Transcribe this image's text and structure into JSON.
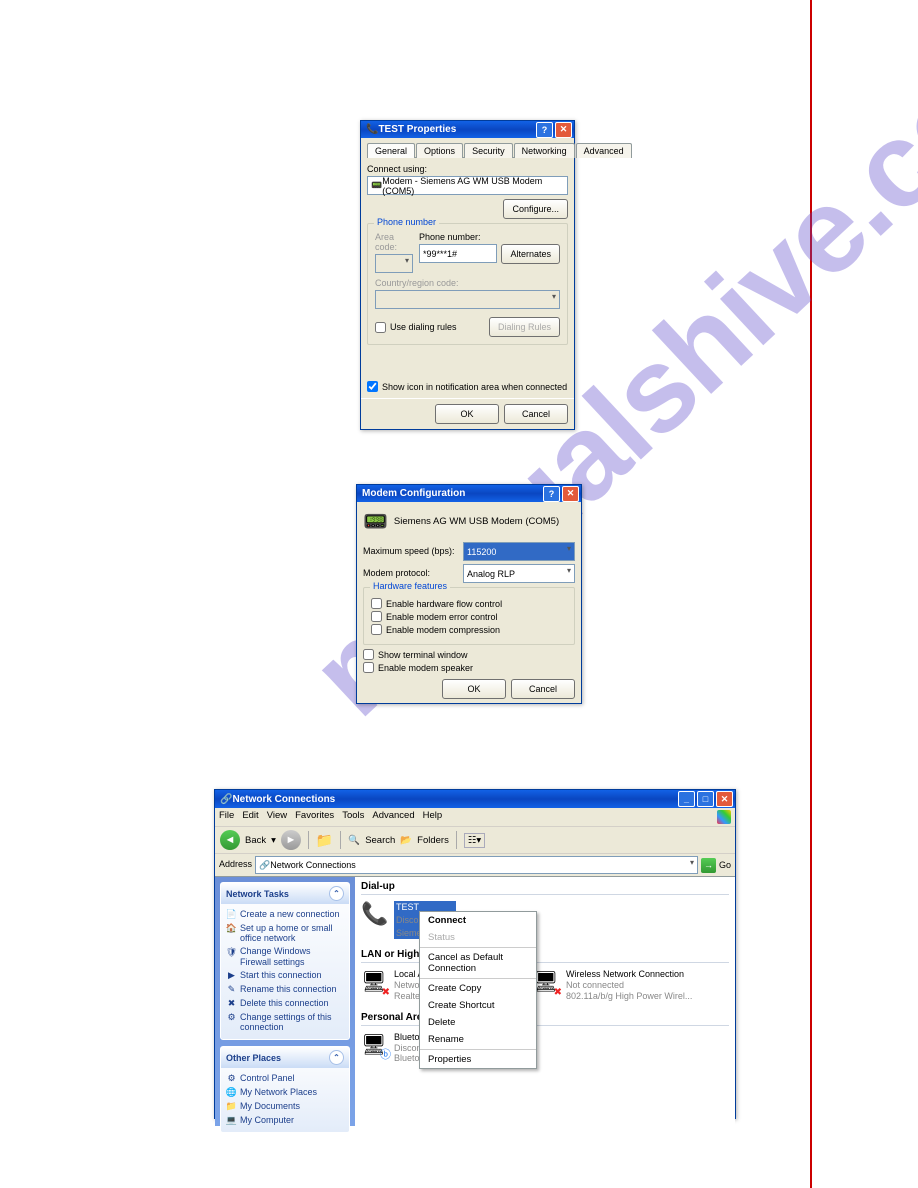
{
  "watermark": "manualshive.com",
  "win1": {
    "title": "TEST Properties",
    "tabs": [
      "General",
      "Options",
      "Security",
      "Networking",
      "Advanced"
    ],
    "connect_using_label": "Connect using:",
    "modem": "Modem - Siemens AG WM USB Modem (COM5)",
    "configure": "Configure...",
    "phone_group": "Phone number",
    "area_code_label": "Area code:",
    "phone_label": "Phone number:",
    "phone_value": "*99***1#",
    "alternates": "Alternates",
    "country_label": "Country/region code:",
    "use_dialing": "Use dialing rules",
    "dialing_rules": "Dialing Rules",
    "show_icon": "Show icon in notification area when connected",
    "ok": "OK",
    "cancel": "Cancel"
  },
  "win2": {
    "title": "Modem Configuration",
    "device": "Siemens AG WM USB Modem (COM5)",
    "max_speed_label": "Maximum speed (bps):",
    "max_speed": "115200",
    "protocol_label": "Modem protocol:",
    "protocol": "Analog RLP",
    "hw_group": "Hardware features",
    "hw1": "Enable hardware flow control",
    "hw2": "Enable modem error control",
    "hw3": "Enable modem compression",
    "show_term": "Show terminal window",
    "speaker": "Enable modem speaker",
    "ok": "OK",
    "cancel": "Cancel"
  },
  "win3": {
    "title": "Network Connections",
    "menu": [
      "File",
      "Edit",
      "View",
      "Favorites",
      "Tools",
      "Advanced",
      "Help"
    ],
    "back": "Back",
    "search": "Search",
    "folders": "Folders",
    "addr_label": "Address",
    "addr": "Network Connections",
    "go": "Go",
    "tasks_title": "Network Tasks",
    "tasks": [
      "Create a new connection",
      "Set up a home or small office network",
      "Change Windows Firewall settings",
      "Start this connection",
      "Rename this connection",
      "Delete this connection",
      "Change settings of this connection"
    ],
    "places_title": "Other Places",
    "places": [
      "Control Panel",
      "My Network Places",
      "My Documents",
      "My Computer"
    ],
    "g1": "Dial-up",
    "g2": "LAN or High-Speed Internet",
    "g3": "Personal Area Network",
    "conn_test": {
      "name": "TEST",
      "line2": "Disconnected",
      "line3": "Siemens AG..."
    },
    "conn_local": {
      "name": "Local Area Connection",
      "line2": "Network cable un...",
      "line3": "Realtek RTL8..."
    },
    "conn_wifi": {
      "name": "Wireless Network Connection",
      "line2": "Not connected",
      "line3": "802.11a/b/g High Power Wirel..."
    },
    "conn_bt": {
      "name": "Bluetooth Network Connection",
      "line2": "Disconnected",
      "line3": "Bluetooth Device (Personal Ar..."
    },
    "ctx": [
      "Connect",
      "Status",
      "Cancel as Default Connection",
      "Create Copy",
      "Create Shortcut",
      "Delete",
      "Rename",
      "Properties"
    ]
  }
}
